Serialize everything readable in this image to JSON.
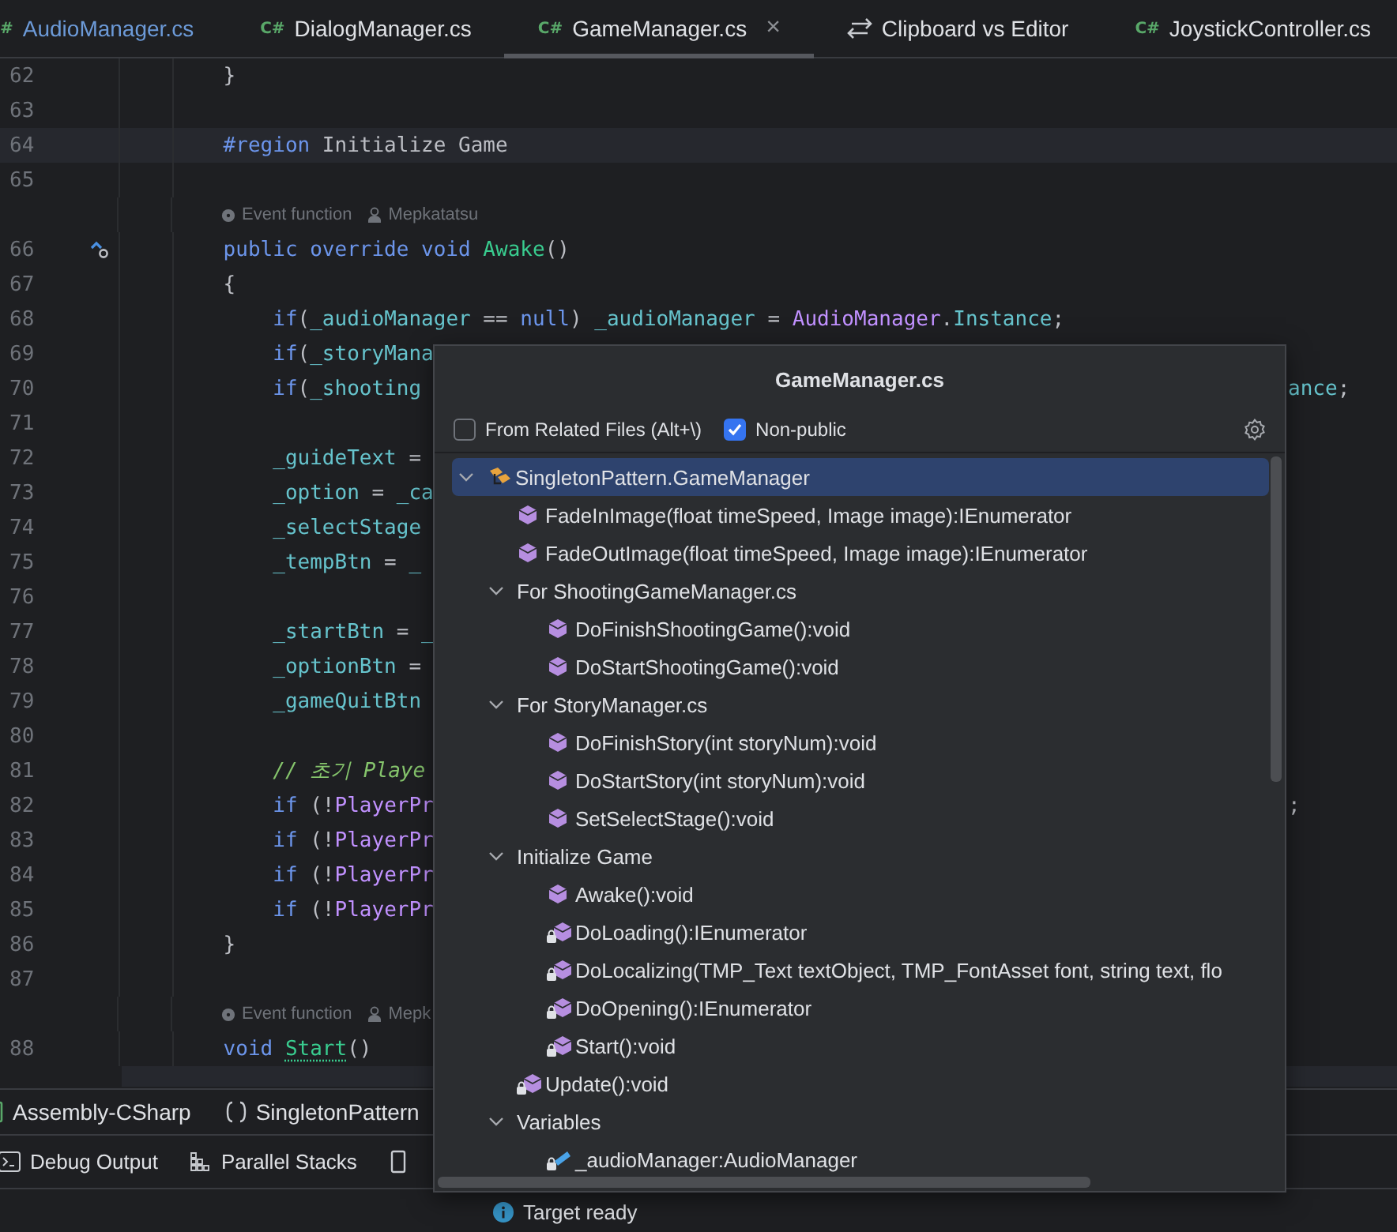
{
  "tabs": [
    {
      "kind": "csharp",
      "icon_text": "#",
      "label": "AudioManager.cs",
      "color": "#6c9ad8",
      "selected": false
    },
    {
      "kind": "csharp",
      "icon_text": "C#",
      "label": "DialogManager.cs",
      "color": "#dfe1e5",
      "selected": false
    },
    {
      "kind": "csharp",
      "icon_text": "C#",
      "label": "GameManager.cs",
      "color": "#dfe1e5",
      "selected": true,
      "close": "×"
    },
    {
      "kind": "compare",
      "label": "Clipboard vs Editor",
      "color": "#dfe1e5",
      "selected": false
    },
    {
      "kind": "csharp",
      "icon_text": "C#",
      "label": "JoystickController.cs",
      "color": "#dfe1e5",
      "selected": false
    }
  ],
  "editor": {
    "lines": [
      {
        "kind": "code",
        "number": "62",
        "current": false,
        "tokens": [
          {
            "kind": "plain",
            "text": "    }"
          }
        ]
      },
      {
        "kind": "code",
        "number": "63",
        "current": false
      },
      {
        "kind": "code",
        "number": "64",
        "current": true,
        "tokens": [
          {
            "kind": "keyword",
            "text": "    #region"
          },
          {
            "kind": "plain",
            "text": " Initialize Game"
          }
        ]
      },
      {
        "kind": "code",
        "number": "65",
        "current": false
      },
      {
        "kind": "hint",
        "hints": [
          "Event function",
          "Mepkatatsu"
        ]
      },
      {
        "kind": "override",
        "number": "66",
        "current": false,
        "tokens": [
          {
            "kind": "keyword",
            "text": "    public override void "
          },
          {
            "kind": "method",
            "text": "Awake"
          },
          {
            "kind": "plain",
            "text": "()"
          }
        ]
      },
      {
        "kind": "code",
        "number": "67",
        "current": false,
        "tokens": [
          {
            "kind": "plain",
            "text": "    {"
          }
        ]
      },
      {
        "kind": "code",
        "number": "68",
        "current": false,
        "tokens": [
          {
            "kind": "keyword",
            "text": "        if"
          },
          {
            "kind": "plain",
            "text": "("
          },
          {
            "kind": "field",
            "text": "_audioManager"
          },
          {
            "kind": "plain",
            "text": " == "
          },
          {
            "kind": "keyword",
            "text": "null"
          },
          {
            "kind": "plain",
            "text": ") "
          },
          {
            "kind": "field",
            "text": "_audioManager"
          },
          {
            "kind": "plain",
            "text": " = "
          },
          {
            "kind": "type",
            "text": "AudioManager"
          },
          {
            "kind": "plain",
            "text": "."
          },
          {
            "kind": "field",
            "text": "Instance"
          },
          {
            "kind": "plain",
            "text": ";"
          }
        ]
      },
      {
        "kind": "code",
        "number": "69",
        "current": false,
        "tokens": [
          {
            "kind": "keyword",
            "text": "        if"
          },
          {
            "kind": "plain",
            "text": "("
          },
          {
            "kind": "field",
            "text": "_storyMana"
          }
        ]
      },
      {
        "kind": "code",
        "number": "70",
        "current": false,
        "tokens": [
          {
            "kind": "keyword",
            "text": "        if"
          },
          {
            "kind": "plain",
            "text": "("
          },
          {
            "kind": "field",
            "text": "_shooting"
          }
        ],
        "tail": [
          {
            "kind": "field",
            "text": "ance"
          },
          {
            "kind": "plain",
            "text": ";"
          }
        ]
      },
      {
        "kind": "code",
        "number": "71",
        "current": false
      },
      {
        "kind": "code",
        "number": "72",
        "current": false,
        "tokens": [
          {
            "kind": "field",
            "text": "        _guideText"
          },
          {
            "kind": "plain",
            "text": " ="
          }
        ]
      },
      {
        "kind": "code",
        "number": "73",
        "current": false,
        "tokens": [
          {
            "kind": "field",
            "text": "        _option"
          },
          {
            "kind": "plain",
            "text": " = "
          },
          {
            "kind": "field",
            "text": "_ca"
          }
        ]
      },
      {
        "kind": "code",
        "number": "74",
        "current": false,
        "tokens": [
          {
            "kind": "field",
            "text": "        _selectStage"
          }
        ]
      },
      {
        "kind": "code",
        "number": "75",
        "current": false,
        "tokens": [
          {
            "kind": "field",
            "text": "        _tempBtn"
          },
          {
            "kind": "plain",
            "text": " = "
          },
          {
            "kind": "field",
            "text": "_"
          }
        ]
      },
      {
        "kind": "code",
        "number": "76",
        "current": false
      },
      {
        "kind": "code",
        "number": "77",
        "current": false,
        "tokens": [
          {
            "kind": "field",
            "text": "        _startBtn"
          },
          {
            "kind": "plain",
            "text": " = "
          },
          {
            "kind": "field",
            "text": "_"
          }
        ]
      },
      {
        "kind": "code",
        "number": "78",
        "current": false,
        "tokens": [
          {
            "kind": "field",
            "text": "        _optionBtn"
          },
          {
            "kind": "plain",
            "text": " ="
          }
        ]
      },
      {
        "kind": "code",
        "number": "79",
        "current": false,
        "tokens": [
          {
            "kind": "field",
            "text": "        _gameQuitBtn"
          }
        ]
      },
      {
        "kind": "code",
        "number": "80",
        "current": false
      },
      {
        "kind": "code",
        "number": "81",
        "current": false,
        "tokens": [
          {
            "kind": "comment",
            "text": "        // 초기 Playe"
          }
        ]
      },
      {
        "kind": "code",
        "number": "82",
        "current": false,
        "tokens": [
          {
            "kind": "keyword",
            "text": "        if"
          },
          {
            "kind": "plain",
            "text": " (!"
          },
          {
            "kind": "type",
            "text": "PlayerPr"
          }
        ],
        "tail": [
          {
            "kind": "plain",
            "text": ";"
          }
        ]
      },
      {
        "kind": "code",
        "number": "83",
        "current": false,
        "tokens": [
          {
            "kind": "keyword",
            "text": "        if"
          },
          {
            "kind": "plain",
            "text": " (!"
          },
          {
            "kind": "type",
            "text": "PlayerPr"
          }
        ]
      },
      {
        "kind": "code",
        "number": "84",
        "current": false,
        "tokens": [
          {
            "kind": "keyword",
            "text": "        if"
          },
          {
            "kind": "plain",
            "text": " (!"
          },
          {
            "kind": "type",
            "text": "PlayerPr"
          }
        ]
      },
      {
        "kind": "code",
        "number": "85",
        "current": false,
        "tokens": [
          {
            "kind": "keyword",
            "text": "        if"
          },
          {
            "kind": "plain",
            "text": " (!"
          },
          {
            "kind": "type",
            "text": "PlayerPr"
          }
        ]
      },
      {
        "kind": "code",
        "number": "86",
        "current": false,
        "tokens": [
          {
            "kind": "plain",
            "text": "    }"
          }
        ]
      },
      {
        "kind": "code",
        "number": "87",
        "current": false
      },
      {
        "kind": "hint",
        "hints": [
          "Event function",
          "Mepk"
        ]
      },
      {
        "kind": "code",
        "number": "88",
        "current": false,
        "tokens": [
          {
            "kind": "keyword",
            "text": "    void "
          },
          {
            "kind": "method-unused",
            "text": "Start"
          },
          {
            "kind": "plain",
            "text": "()"
          }
        ]
      }
    ]
  },
  "popup": {
    "title": "GameManager.cs",
    "options": [
      {
        "label": "From Related Files (Alt+\\)",
        "checked": false
      },
      {
        "label": "Non-public",
        "checked": true
      }
    ],
    "tree": [
      {
        "kind": "class",
        "label": "SingletonPattern.GameManager",
        "expanded": true,
        "selected": true,
        "children": [
          {
            "kind": "method",
            "label": "FadeInImage(float timeSpeed, Image image):IEnumerator",
            "selected": false
          },
          {
            "kind": "method",
            "label": "FadeOutImage(float timeSpeed, Image image):IEnumerator",
            "selected": false
          },
          {
            "kind": "region",
            "label": "For ShootingGameManager.cs",
            "expanded": true,
            "selected": false,
            "children": [
              {
                "kind": "method",
                "label": "DoFinishShootingGame():void",
                "selected": false
              },
              {
                "kind": "method",
                "label": "DoStartShootingGame():void",
                "selected": false
              }
            ]
          },
          {
            "kind": "region",
            "label": "For StoryManager.cs",
            "expanded": true,
            "selected": false,
            "children": [
              {
                "kind": "method",
                "label": "DoFinishStory(int storyNum):void",
                "selected": false
              },
              {
                "kind": "method",
                "label": "DoStartStory(int storyNum):void",
                "selected": false
              },
              {
                "kind": "method",
                "label": "SetSelectStage():void",
                "selected": false
              }
            ]
          },
          {
            "kind": "region",
            "label": "Initialize Game",
            "expanded": true,
            "selected": false,
            "children": [
              {
                "kind": "method",
                "label": "Awake():void",
                "selected": false
              },
              {
                "kind": "private-method",
                "label": "DoLoading():IEnumerator",
                "selected": false
              },
              {
                "kind": "private-method",
                "label": "DoLocalizing(TMP_Text textObject, TMP_FontAsset font, string text, flo",
                "selected": false
              },
              {
                "kind": "private-method",
                "label": "DoOpening():IEnumerator",
                "selected": false
              },
              {
                "kind": "private-method",
                "label": "Start():void",
                "selected": false
              }
            ]
          },
          {
            "kind": "private-method",
            "label": "Update():void",
            "selected": false
          },
          {
            "kind": "region",
            "label": "Variables",
            "expanded": true,
            "selected": false,
            "children": [
              {
                "kind": "private-field",
                "label": "_audioManager:AudioManager",
                "selected": false
              }
            ]
          }
        ]
      }
    ]
  },
  "breadcrumb": [
    {
      "kind": "assembly",
      "label": "Assembly-CSharp"
    },
    {
      "kind": "namespace",
      "label": "SingletonPattern"
    }
  ],
  "tool_windows": [
    {
      "kind": "terminal",
      "label": "Debug Output"
    },
    {
      "kind": "stacks",
      "label": "Parallel Stacks"
    },
    {
      "kind": "panel"
    }
  ],
  "status_bar": {
    "kind": "info",
    "text": "Target ready"
  }
}
